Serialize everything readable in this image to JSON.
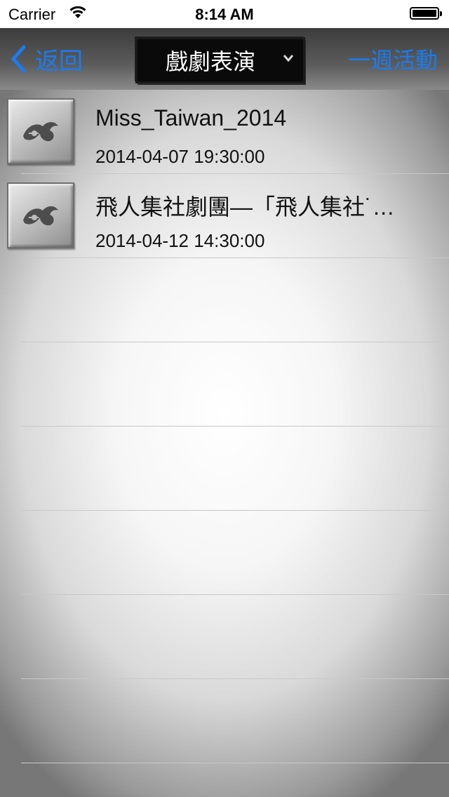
{
  "status_bar": {
    "carrier": "Carrier",
    "time": "8:14 AM"
  },
  "navbar": {
    "back_label": "返回",
    "category_label": "戲劇表演",
    "week_label": "一週活動"
  },
  "events": [
    {
      "title": "Miss_Taiwan_2014",
      "date": "2014-04-07 19:30:00"
    },
    {
      "title": "飛人集社劇團—「飛人集社˙…",
      "date": "2014-04-12 14:30:00"
    }
  ],
  "colors": {
    "accent": "#1a7cf0"
  }
}
